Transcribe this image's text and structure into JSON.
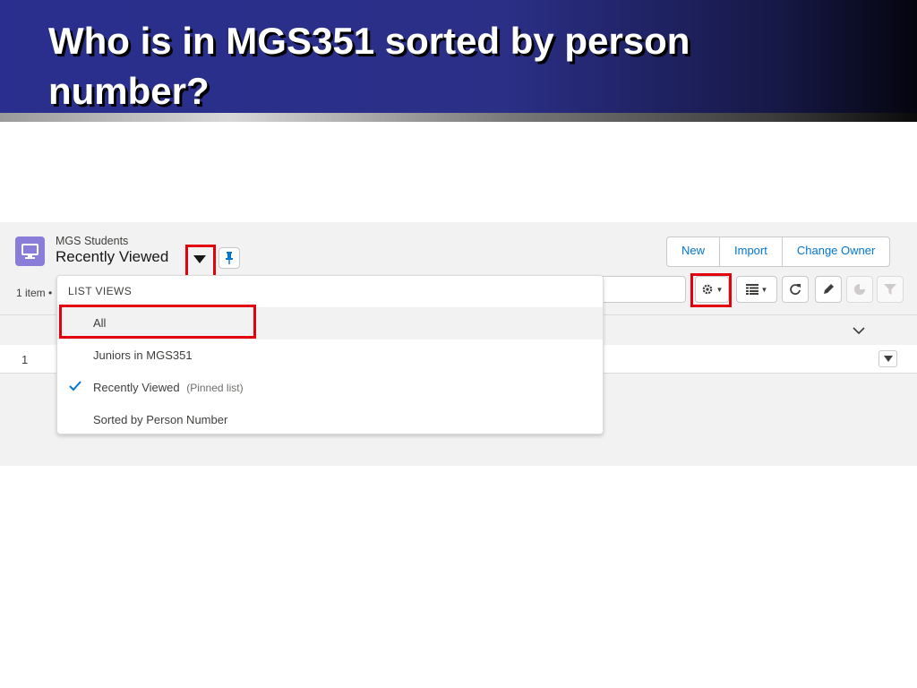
{
  "slide": {
    "title": "Who is in MGS351 sorted by person number?"
  },
  "list_header": {
    "object_name": "MGS Students",
    "view_name": "Recently Viewed"
  },
  "actions": {
    "new_label": "New",
    "import_label": "Import",
    "change_owner_label": "Change Owner"
  },
  "list_info": {
    "item_count": "1 item •"
  },
  "dropdown": {
    "heading": "LIST VIEWS",
    "items": [
      {
        "label": "All",
        "note": ""
      },
      {
        "label": "Juniors in MGS351",
        "note": ""
      },
      {
        "label": "Recently Viewed",
        "note": "(Pinned list)"
      },
      {
        "label": "Sorted by Person Number",
        "note": ""
      }
    ]
  },
  "table": {
    "rows": [
      {
        "number": "1"
      }
    ]
  },
  "colors": {
    "highlight": "#e3000f",
    "brand_blue": "#0176d3",
    "object_icon": "#8a7cd9",
    "header_blue": "#2a2f8f"
  },
  "icons": {
    "object": "desktop-icon",
    "view_menu": "caret-down-icon",
    "pin": "pin-icon",
    "settings": "gear-icon",
    "display_as": "table-icon",
    "refresh": "refresh-icon",
    "edit": "pencil-icon",
    "charts": "chart-icon",
    "filter": "filter-icon",
    "column_menu": "chevron-down-icon",
    "row_menu": "caret-down-icon",
    "checked": "check-icon"
  }
}
